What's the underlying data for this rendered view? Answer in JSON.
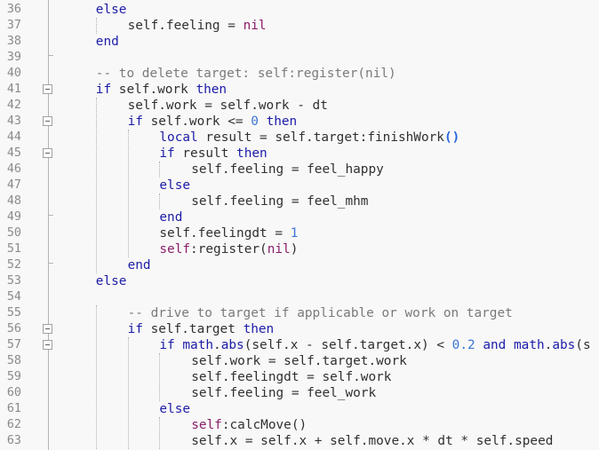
{
  "editor": {
    "lines": [
      {
        "num": "36",
        "indent": 1,
        "tokens": [
          {
            "t": "kw",
            "v": "else"
          }
        ]
      },
      {
        "num": "37",
        "indent": 2,
        "tokens": [
          {
            "t": "",
            "v": "self.feeling = "
          },
          {
            "t": "nil",
            "v": "nil"
          }
        ]
      },
      {
        "num": "38",
        "indent": 1,
        "tokens": [
          {
            "t": "kw",
            "v": "end"
          }
        ]
      },
      {
        "num": "39",
        "indent": 0,
        "tokens": []
      },
      {
        "num": "40",
        "indent": 1,
        "tokens": [
          {
            "t": "cm",
            "v": "-- to delete target: self:register(nil)"
          }
        ]
      },
      {
        "num": "41",
        "indent": 1,
        "tokens": [
          {
            "t": "kw",
            "v": "if"
          },
          {
            "t": "",
            "v": " self.work "
          },
          {
            "t": "kw",
            "v": "then"
          }
        ]
      },
      {
        "num": "42",
        "indent": 2,
        "tokens": [
          {
            "t": "",
            "v": "self.work = self.work - dt"
          }
        ]
      },
      {
        "num": "43",
        "indent": 2,
        "tokens": [
          {
            "t": "kw",
            "v": "if"
          },
          {
            "t": "",
            "v": " self.work <= "
          },
          {
            "t": "num",
            "v": "0"
          },
          {
            "t": "",
            "v": " "
          },
          {
            "t": "kw",
            "v": "then"
          }
        ]
      },
      {
        "num": "44",
        "indent": 3,
        "tokens": [
          {
            "t": "kw",
            "v": "local"
          },
          {
            "t": "",
            "v": " result = self.target:finishWork"
          },
          {
            "t": "paren",
            "v": "()"
          }
        ]
      },
      {
        "num": "45",
        "indent": 3,
        "tokens": [
          {
            "t": "kw",
            "v": "if"
          },
          {
            "t": "",
            "v": " result "
          },
          {
            "t": "kw",
            "v": "then"
          }
        ]
      },
      {
        "num": "46",
        "indent": 4,
        "tokens": [
          {
            "t": "",
            "v": "self.feeling = feel_happy"
          }
        ]
      },
      {
        "num": "47",
        "indent": 3,
        "tokens": [
          {
            "t": "kw",
            "v": "else"
          }
        ]
      },
      {
        "num": "48",
        "indent": 4,
        "tokens": [
          {
            "t": "",
            "v": "self.feeling = feel_mhm"
          }
        ]
      },
      {
        "num": "49",
        "indent": 3,
        "tokens": [
          {
            "t": "kw",
            "v": "end"
          }
        ]
      },
      {
        "num": "50",
        "indent": 3,
        "tokens": [
          {
            "t": "",
            "v": "self.feelingdt = "
          },
          {
            "t": "num",
            "v": "1"
          }
        ]
      },
      {
        "num": "51",
        "indent": 3,
        "tokens": [
          {
            "t": "self",
            "v": "self"
          },
          {
            "t": "",
            "v": ":register("
          },
          {
            "t": "nil",
            "v": "nil"
          },
          {
            "t": "",
            "v": ")"
          }
        ]
      },
      {
        "num": "52",
        "indent": 2,
        "tokens": [
          {
            "t": "kw",
            "v": "end"
          }
        ]
      },
      {
        "num": "53",
        "indent": 1,
        "tokens": [
          {
            "t": "kw",
            "v": "else"
          }
        ]
      },
      {
        "num": "54",
        "indent": 0,
        "tokens": []
      },
      {
        "num": "55",
        "indent": 2,
        "tokens": [
          {
            "t": "cm",
            "v": "-- drive to target if applicable or work on target"
          }
        ]
      },
      {
        "num": "56",
        "indent": 2,
        "tokens": [
          {
            "t": "kw",
            "v": "if"
          },
          {
            "t": "",
            "v": " self.target "
          },
          {
            "t": "kw",
            "v": "then"
          }
        ]
      },
      {
        "num": "57",
        "indent": 3,
        "tokens": [
          {
            "t": "kw",
            "v": "if"
          },
          {
            "t": "",
            "v": " "
          },
          {
            "t": "kw",
            "v": "math"
          },
          {
            "t": "",
            "v": "."
          },
          {
            "t": "kw",
            "v": "abs"
          },
          {
            "t": "",
            "v": "(self.x - self.target.x) < "
          },
          {
            "t": "num",
            "v": "0.2"
          },
          {
            "t": "",
            "v": " "
          },
          {
            "t": "kw",
            "v": "and"
          },
          {
            "t": "",
            "v": " "
          },
          {
            "t": "kw",
            "v": "math"
          },
          {
            "t": "",
            "v": "."
          },
          {
            "t": "kw",
            "v": "abs"
          },
          {
            "t": "",
            "v": "(s"
          }
        ]
      },
      {
        "num": "58",
        "indent": 4,
        "tokens": [
          {
            "t": "",
            "v": "self.work = self.target.work"
          }
        ]
      },
      {
        "num": "59",
        "indent": 4,
        "tokens": [
          {
            "t": "",
            "v": "self.feelingdt = self.work"
          }
        ]
      },
      {
        "num": "60",
        "indent": 4,
        "tokens": [
          {
            "t": "",
            "v": "self.feeling = feel_work"
          }
        ]
      },
      {
        "num": "61",
        "indent": 3,
        "tokens": [
          {
            "t": "kw",
            "v": "else"
          }
        ]
      },
      {
        "num": "62",
        "indent": 4,
        "tokens": [
          {
            "t": "self",
            "v": "self"
          },
          {
            "t": "",
            "v": ":calcMove()"
          }
        ]
      },
      {
        "num": "63",
        "indent": 4,
        "tokens": [
          {
            "t": "",
            "v": "self.x = self.x + self.move.x * dt * self.speed"
          }
        ]
      }
    ],
    "fold_markers": [
      {
        "line": "41",
        "kind": "box"
      },
      {
        "line": "43",
        "kind": "box"
      },
      {
        "line": "45",
        "kind": "box"
      },
      {
        "line": "56",
        "kind": "box"
      },
      {
        "line": "57",
        "kind": "box"
      },
      {
        "line": "39",
        "kind": "end"
      },
      {
        "line": "49",
        "kind": "end"
      },
      {
        "line": "52",
        "kind": "end"
      }
    ],
    "colors": {
      "background": "#f8f8f8",
      "keyword": "#1c1ca8",
      "comment": "#7a7a7a",
      "number": "#3c74d8",
      "nil": "#8a1e6a",
      "text": "#303030"
    }
  }
}
